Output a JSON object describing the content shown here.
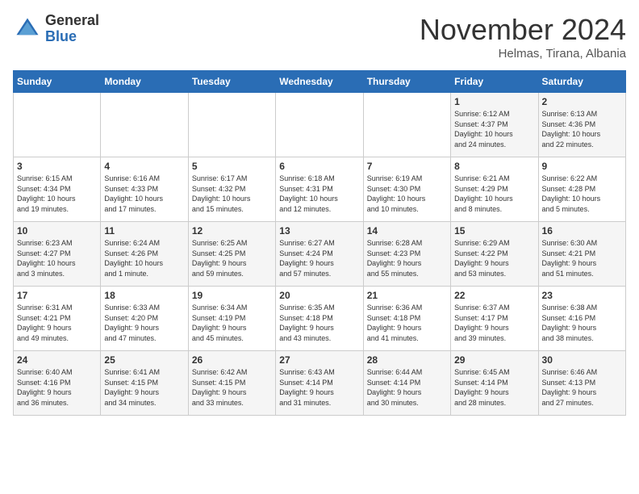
{
  "logo": {
    "general": "General",
    "blue": "Blue"
  },
  "title": "November 2024",
  "subtitle": "Helmas, Tirana, Albania",
  "days_header": [
    "Sunday",
    "Monday",
    "Tuesday",
    "Wednesday",
    "Thursday",
    "Friday",
    "Saturday"
  ],
  "weeks": [
    [
      {
        "day": "",
        "info": ""
      },
      {
        "day": "",
        "info": ""
      },
      {
        "day": "",
        "info": ""
      },
      {
        "day": "",
        "info": ""
      },
      {
        "day": "",
        "info": ""
      },
      {
        "day": "1",
        "info": "Sunrise: 6:12 AM\nSunset: 4:37 PM\nDaylight: 10 hours\nand 24 minutes."
      },
      {
        "day": "2",
        "info": "Sunrise: 6:13 AM\nSunset: 4:36 PM\nDaylight: 10 hours\nand 22 minutes."
      }
    ],
    [
      {
        "day": "3",
        "info": "Sunrise: 6:15 AM\nSunset: 4:34 PM\nDaylight: 10 hours\nand 19 minutes."
      },
      {
        "day": "4",
        "info": "Sunrise: 6:16 AM\nSunset: 4:33 PM\nDaylight: 10 hours\nand 17 minutes."
      },
      {
        "day": "5",
        "info": "Sunrise: 6:17 AM\nSunset: 4:32 PM\nDaylight: 10 hours\nand 15 minutes."
      },
      {
        "day": "6",
        "info": "Sunrise: 6:18 AM\nSunset: 4:31 PM\nDaylight: 10 hours\nand 12 minutes."
      },
      {
        "day": "7",
        "info": "Sunrise: 6:19 AM\nSunset: 4:30 PM\nDaylight: 10 hours\nand 10 minutes."
      },
      {
        "day": "8",
        "info": "Sunrise: 6:21 AM\nSunset: 4:29 PM\nDaylight: 10 hours\nand 8 minutes."
      },
      {
        "day": "9",
        "info": "Sunrise: 6:22 AM\nSunset: 4:28 PM\nDaylight: 10 hours\nand 5 minutes."
      }
    ],
    [
      {
        "day": "10",
        "info": "Sunrise: 6:23 AM\nSunset: 4:27 PM\nDaylight: 10 hours\nand 3 minutes."
      },
      {
        "day": "11",
        "info": "Sunrise: 6:24 AM\nSunset: 4:26 PM\nDaylight: 10 hours\nand 1 minute."
      },
      {
        "day": "12",
        "info": "Sunrise: 6:25 AM\nSunset: 4:25 PM\nDaylight: 9 hours\nand 59 minutes."
      },
      {
        "day": "13",
        "info": "Sunrise: 6:27 AM\nSunset: 4:24 PM\nDaylight: 9 hours\nand 57 minutes."
      },
      {
        "day": "14",
        "info": "Sunrise: 6:28 AM\nSunset: 4:23 PM\nDaylight: 9 hours\nand 55 minutes."
      },
      {
        "day": "15",
        "info": "Sunrise: 6:29 AM\nSunset: 4:22 PM\nDaylight: 9 hours\nand 53 minutes."
      },
      {
        "day": "16",
        "info": "Sunrise: 6:30 AM\nSunset: 4:21 PM\nDaylight: 9 hours\nand 51 minutes."
      }
    ],
    [
      {
        "day": "17",
        "info": "Sunrise: 6:31 AM\nSunset: 4:21 PM\nDaylight: 9 hours\nand 49 minutes."
      },
      {
        "day": "18",
        "info": "Sunrise: 6:33 AM\nSunset: 4:20 PM\nDaylight: 9 hours\nand 47 minutes."
      },
      {
        "day": "19",
        "info": "Sunrise: 6:34 AM\nSunset: 4:19 PM\nDaylight: 9 hours\nand 45 minutes."
      },
      {
        "day": "20",
        "info": "Sunrise: 6:35 AM\nSunset: 4:18 PM\nDaylight: 9 hours\nand 43 minutes."
      },
      {
        "day": "21",
        "info": "Sunrise: 6:36 AM\nSunset: 4:18 PM\nDaylight: 9 hours\nand 41 minutes."
      },
      {
        "day": "22",
        "info": "Sunrise: 6:37 AM\nSunset: 4:17 PM\nDaylight: 9 hours\nand 39 minutes."
      },
      {
        "day": "23",
        "info": "Sunrise: 6:38 AM\nSunset: 4:16 PM\nDaylight: 9 hours\nand 38 minutes."
      }
    ],
    [
      {
        "day": "24",
        "info": "Sunrise: 6:40 AM\nSunset: 4:16 PM\nDaylight: 9 hours\nand 36 minutes."
      },
      {
        "day": "25",
        "info": "Sunrise: 6:41 AM\nSunset: 4:15 PM\nDaylight: 9 hours\nand 34 minutes."
      },
      {
        "day": "26",
        "info": "Sunrise: 6:42 AM\nSunset: 4:15 PM\nDaylight: 9 hours\nand 33 minutes."
      },
      {
        "day": "27",
        "info": "Sunrise: 6:43 AM\nSunset: 4:14 PM\nDaylight: 9 hours\nand 31 minutes."
      },
      {
        "day": "28",
        "info": "Sunrise: 6:44 AM\nSunset: 4:14 PM\nDaylight: 9 hours\nand 30 minutes."
      },
      {
        "day": "29",
        "info": "Sunrise: 6:45 AM\nSunset: 4:14 PM\nDaylight: 9 hours\nand 28 minutes."
      },
      {
        "day": "30",
        "info": "Sunrise: 6:46 AM\nSunset: 4:13 PM\nDaylight: 9 hours\nand 27 minutes."
      }
    ]
  ]
}
